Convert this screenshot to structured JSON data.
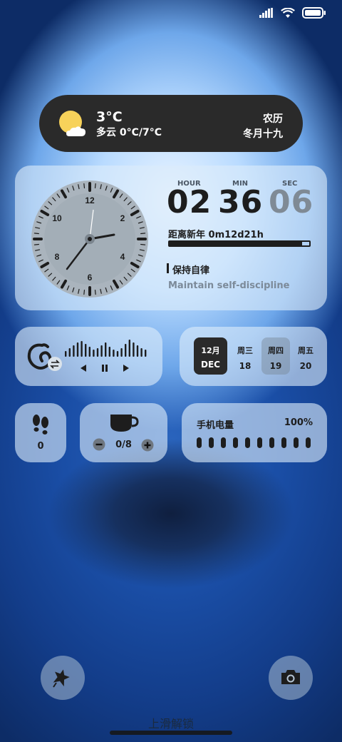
{
  "status": {
    "signal_icon": "signal-bars-icon",
    "wifi_icon": "wifi-icon",
    "battery_icon": "battery-icon"
  },
  "weather": {
    "icon": "partly-cloudy-icon",
    "temp": "3°C",
    "desc": "多云  0°C/7°C",
    "lunar_label": "农历",
    "lunar_date": "冬月十九"
  },
  "clock": {
    "hour_label": "HOUR",
    "min_label": "MIN",
    "sec_label": "SEC",
    "hour": "02",
    "min": "36",
    "sec": "06",
    "dial_numbers": [
      "12",
      "2",
      "4",
      "6",
      "8",
      "10"
    ],
    "countdown": "距离新年  0m12d21h",
    "progress": 0.95,
    "motto": "保持自律",
    "motto_en": "Maintain self-discipline"
  },
  "music": {
    "app_icon": "netease-music-icon",
    "switch_icon": "switch-icon",
    "prev_icon": "previous-icon",
    "pause_icon": "pause-icon",
    "next_icon": "next-icon"
  },
  "calendar": {
    "month": "12月",
    "month_en": "DEC",
    "days": [
      {
        "w": "周三",
        "d": "18"
      },
      {
        "w": "周四",
        "d": "19"
      },
      {
        "w": "周五",
        "d": "20"
      }
    ]
  },
  "steps": {
    "icon": "footprints-icon",
    "count": "0"
  },
  "water": {
    "icon": "cup-icon",
    "value": "0/8"
  },
  "battery": {
    "label": "手机电量",
    "percent": "100%",
    "segments": 10
  },
  "shortcuts": {
    "left_icon": "flashlight-icon",
    "right_icon": "camera-icon"
  },
  "unlock_text": "上滑解锁"
}
